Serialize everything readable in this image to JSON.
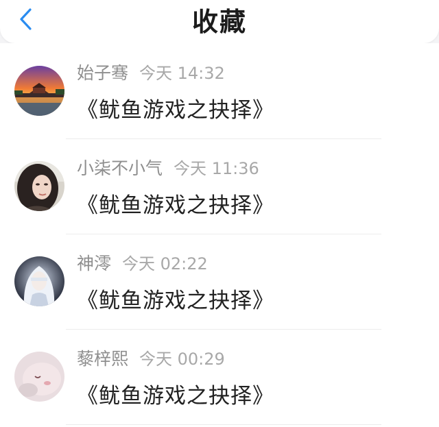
{
  "header": {
    "title": "收藏",
    "back_icon": "chevron-left-icon",
    "accent": "#2a8cf0"
  },
  "favorites": [
    {
      "author": "始子骞",
      "time": "今天 14:32",
      "title": "《鱿鱼游戏之抉择》",
      "avatar": "sunset-palace-photo"
    },
    {
      "author": "小柒不小气",
      "time": "今天 11:36",
      "title": "《鱿鱼游戏之抉择》",
      "avatar": "girl-portrait-photo"
    },
    {
      "author": "神澪",
      "time": "今天 02:22",
      "title": "《鱿鱼游戏之抉择》",
      "avatar": "white-hair-anime-photo"
    },
    {
      "author": "藜梓熙",
      "time": "今天 00:29",
      "title": "《鱿鱼游戏之抉择》",
      "avatar": "soft-pink-photo"
    }
  ]
}
